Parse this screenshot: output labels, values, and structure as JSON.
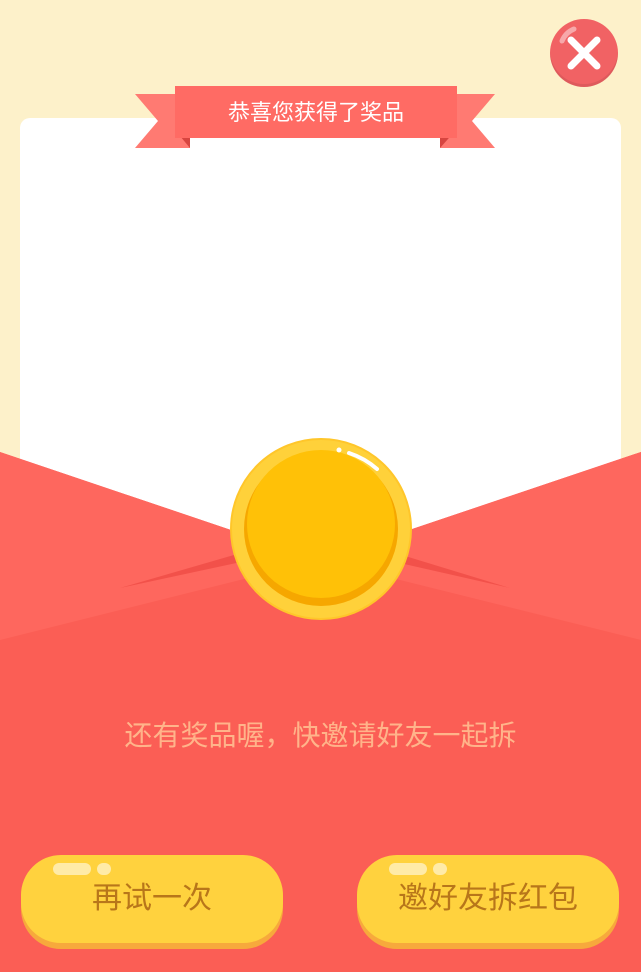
{
  "banner": {
    "title": "恭喜您获得了奖品"
  },
  "close_button": {
    "icon": "close-icon"
  },
  "coin": {
    "icon": "gold-coin-icon"
  },
  "hint_text": "还有奖品喔，快邀请好友一起拆",
  "buttons": {
    "retry_label": "再试一次",
    "invite_label": "邀好友拆红包"
  },
  "colors": {
    "background": "#fdf1ca",
    "envelope_red": "#fb5e55",
    "flap_red": "#fe655c",
    "banner_red": "#ff706a",
    "coin_gold": "#ffc107",
    "button_yellow": "#ffd23e",
    "button_text": "#b8761a",
    "hint_text": "#ffb48a"
  }
}
